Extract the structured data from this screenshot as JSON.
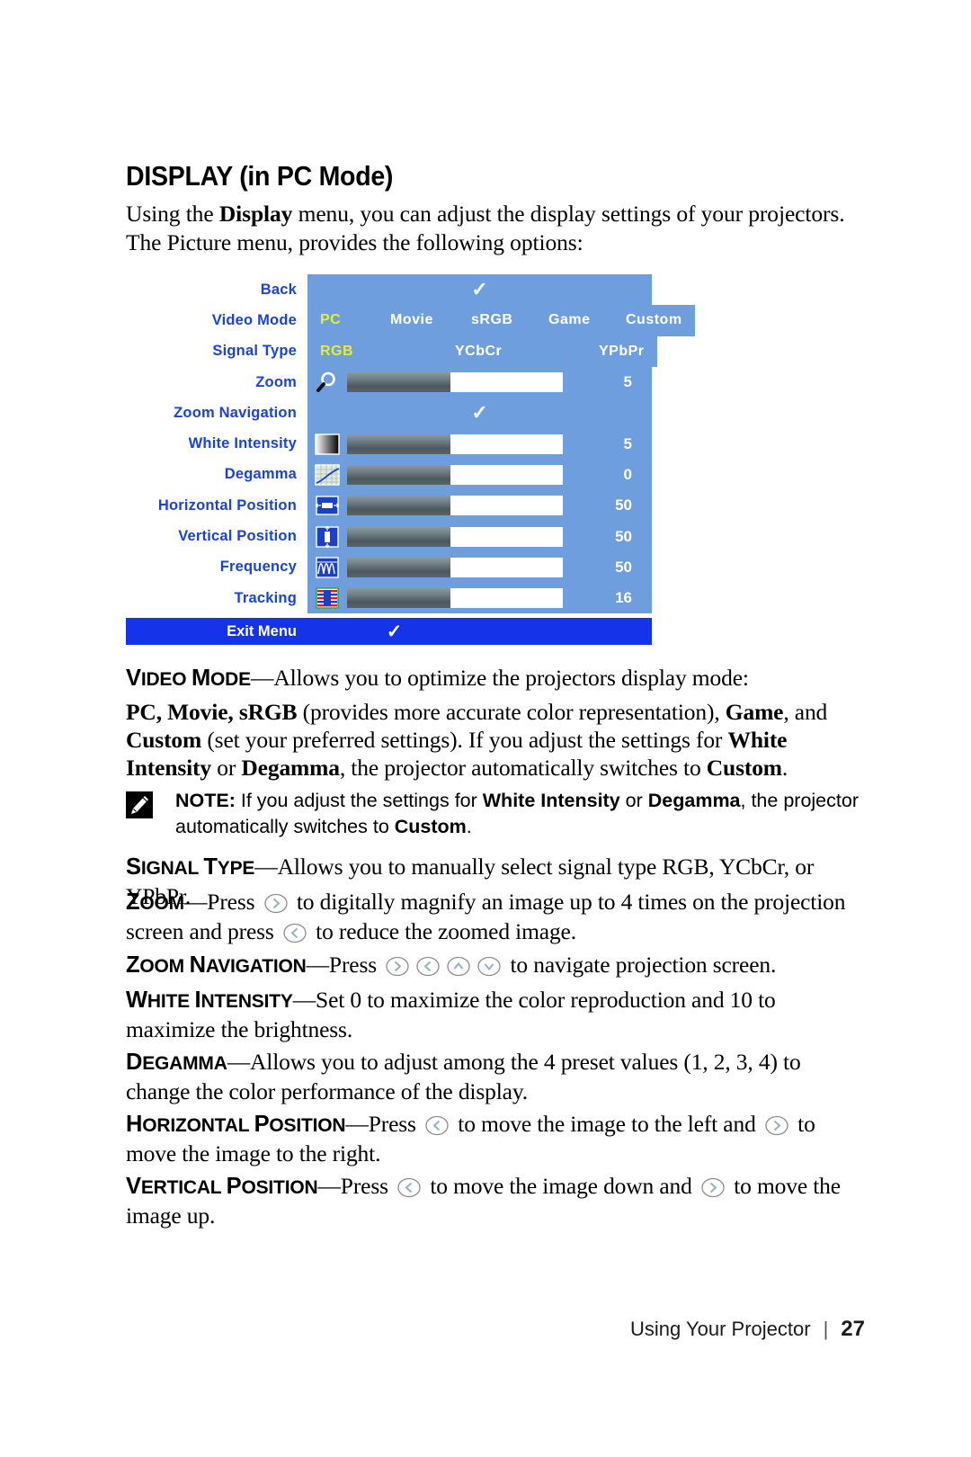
{
  "page": {
    "title": "DISPLAY (in PC Mode)",
    "intro_line1_a": "Using the ",
    "intro_line1_b": "Display",
    "intro_line1_c": " menu, you can adjust the display settings of your projectors.",
    "intro_line2": "The Picture menu, provides the following options:"
  },
  "osd": {
    "rows": [
      {
        "label": "Back",
        "type": "check"
      },
      {
        "label": "Video Mode",
        "type": "options",
        "options": [
          "PC",
          "Movie",
          "sRGB",
          "Game",
          "Custom"
        ],
        "selected": "PC"
      },
      {
        "label": "Signal Type",
        "type": "options",
        "options": [
          "RGB",
          "YCbCr",
          "YPbPr"
        ],
        "selected": "RGB"
      },
      {
        "label": "Zoom",
        "type": "slider",
        "icon": "magnifier-icon",
        "value": "5",
        "fill_pct": 48
      },
      {
        "label": "Zoom Navigation",
        "type": "check"
      },
      {
        "label": "White Intensity",
        "type": "slider",
        "icon": "white-intensity-icon",
        "value": "5",
        "fill_pct": 48
      },
      {
        "label": "Degamma",
        "type": "slider",
        "icon": "degamma-icon",
        "value": "0",
        "fill_pct": 48
      },
      {
        "label": "Horizontal Position",
        "type": "slider",
        "icon": "horizontal-position-icon",
        "value": "50",
        "fill_pct": 48
      },
      {
        "label": "Vertical Position",
        "type": "slider",
        "icon": "vertical-position-icon",
        "value": "50",
        "fill_pct": 48
      },
      {
        "label": "Frequency",
        "type": "slider",
        "icon": "frequency-icon",
        "value": "50",
        "fill_pct": 48
      },
      {
        "label": "Tracking",
        "type": "slider",
        "icon": "tracking-icon",
        "value": "16",
        "fill_pct": 48
      }
    ],
    "exit_label": "Exit Menu",
    "check_glyph": "✓",
    "colors": {
      "menu_bg": "#6e9ede",
      "label_text": "#1b44d6",
      "selected_option": "#e8ef2a",
      "exit_bar": "#1533e8"
    }
  },
  "sections": {
    "video_mode": {
      "term": "Video Mode",
      "term_cap": "V",
      "text": "—Allows you to optimize the projectors display mode:",
      "body_a": "PC, Movie, sRGB",
      "body_b": " (provides more accurate color representation), ",
      "body_c": "Game",
      "body_d": ", and ",
      "body_e": "Custom",
      "body_f": " (set your preferred settings). If you adjust the settings for ",
      "body_g": "White Intensity",
      "body_h": " or ",
      "body_i": "Degamma",
      "body_j": ", the projector automatically switches to ",
      "body_k": "Custom",
      "body_l": "."
    },
    "note": {
      "label": "NOTE:",
      "text_a": " If you adjust the settings for ",
      "text_b": "White Intensity",
      "text_c": " or ",
      "text_d": "Degamma",
      "text_e": ", the projector automatically switches to ",
      "text_f": "Custom",
      "text_g": "."
    },
    "signal_type": {
      "term": "Signal Type",
      "text": "—Allows you to manually select signal type RGB, YCbCr, or YPbPr."
    },
    "zoom": {
      "term": "Zoom",
      "text_a": "—Press ",
      "text_b": " to digitally magnify an image up to 4 times on the projection screen and press ",
      "text_c": " to reduce the zoomed image."
    },
    "zoom_navigation": {
      "term": "Zoom Navigation",
      "text_a": "—Press ",
      "text_b": " to navigate projection screen."
    },
    "white_intensity": {
      "term": "White Intensity",
      "text": "—Set 0 to maximize the color reproduction and 10 to maximize the brightness."
    },
    "degamma": {
      "term": "Degamma",
      "text": "—Allows you to adjust among the 4 preset values (1, 2, 3, 4) to change the color performance of the display."
    },
    "horizontal_position": {
      "term": "Horizontal Position",
      "text_a": "—Press ",
      "text_b": " to move the image to the left and ",
      "text_c": " to move the image to the right."
    },
    "vertical_position": {
      "term": "Vertical Position",
      "text_a": "—Press ",
      "text_b": " to move the image down and ",
      "text_c": " to move the image up."
    }
  },
  "footer": {
    "label": "Using Your Projector",
    "separator": "|",
    "page_number": "27"
  }
}
